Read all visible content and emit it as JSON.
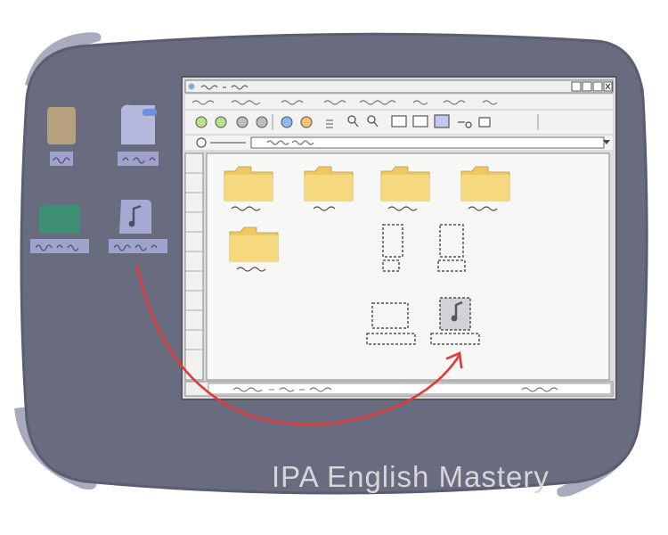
{
  "watermark": "IPA English Mastery",
  "colors": {
    "desktop": "#696b7e",
    "desktop_outline": "#5b5d70",
    "window_bg": "#f4f4f2",
    "window_border": "#55565e",
    "folder": "#f6d97e",
    "folder_tab": "#efc860",
    "arrow": "#e03a3a",
    "icon_tan": "#b6a07d",
    "icon_lavender": "#b7b8de",
    "icon_teal": "#3f8f74",
    "icon_music": "#a8a9d2",
    "label": "#9fa2cc"
  },
  "desktop_icons": [
    {
      "name": "document-icon-tan"
    },
    {
      "name": "document-icon-lavender"
    },
    {
      "name": "file-icon-teal"
    },
    {
      "name": "music-file-icon"
    }
  ],
  "window": {
    "controls": [
      "help-icon",
      "minimize-icon",
      "maximize-icon",
      "close-icon"
    ],
    "toolbar_icons": [
      "go-icon",
      "go-icon",
      "stop-icon",
      "stop-icon",
      "globe-icon",
      "globe-icon",
      "list-icon",
      "search-icon",
      "search-icon",
      "view-icon",
      "view-icon",
      "view-icon",
      "key-icon",
      "tag-icon"
    ],
    "folder_count": 5,
    "placeholder_count": 4,
    "drop_target": "music-file-icon"
  },
  "arrow": {
    "direction": "from desktop music file into the file window"
  }
}
